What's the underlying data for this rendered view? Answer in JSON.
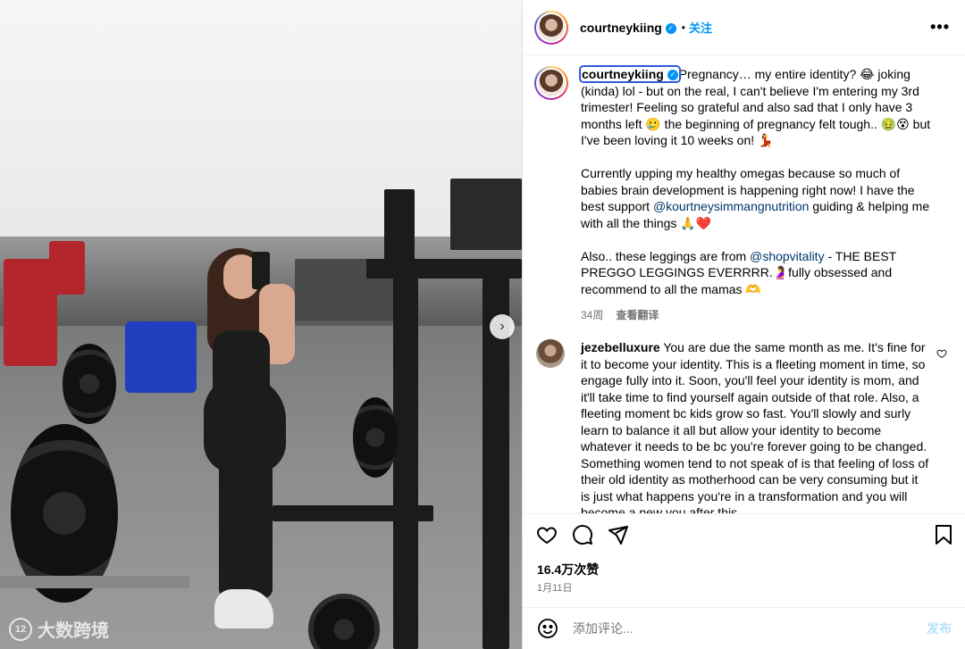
{
  "post": {
    "username": "courtneykiing",
    "follow_label": "关注",
    "more_label": "•••",
    "verified_mark": "✓"
  },
  "caption": {
    "username": "courtneykiing",
    "paragraph1": "Pregnancy… my entire identity? 😂 joking (kinda) lol - but on the real, I can't believe I'm entering my 3rd trimester! Feeling so grateful and also sad that I only have 3 months left 🥲 the beginning of pregnancy felt tough.. 🤢😵 but I've been loving it 10 weeks on! 💃",
    "paragraph2_before": "Currently upping my healthy omegas because so much of babies brain development is happening right now! I have the best support ",
    "paragraph2_mention": "@kourtneysimmangnutrition",
    "paragraph2_after": " guiding & helping me with all the things 🙏❤️",
    "paragraph3_before": "Also.. these leggings are from ",
    "paragraph3_mention": "@shopvitality",
    "paragraph3_after": " - THE BEST PREGGO LEGGINGS EVERRRR.🤰fully obsessed and recommend to all the mamas 🫶",
    "age": "34周",
    "translate_label": "查看翻译"
  },
  "comment": {
    "username": "jezebelluxure",
    "text": "You are due the same month as me. It's fine for it to become your identity. This is a fleeting moment in time, so engage fully into it. Soon, you'll feel your identity is mom, and it'll take time to find yourself again outside of that role. Also, a fleeting moment bc kids grow so fast. You'll slowly and surly learn to balance it all but allow your identity to become whatever it needs to be bc you're forever going to be changed. Something women tend to not speak of is that feeling of loss of their old identity as motherhood can be very consuming but it is just what happens you're in a transformation and you will become a new you after this."
  },
  "stats": {
    "likes": "16.4万次赞",
    "date": "1月11日"
  },
  "add_comment": {
    "placeholder": "添加评论...",
    "post_label": "发布"
  },
  "watermark": {
    "logo": "12",
    "text": "大数跨境"
  },
  "icons": [
    "heart-icon",
    "comment-icon",
    "share-icon",
    "bookmark-icon",
    "emoji-icon",
    "more-icon",
    "chevron-right-icon"
  ],
  "colors": {
    "accent": "#0095f6",
    "mention": "#00376b",
    "muted": "#737373",
    "post_disabled": "#b2dffc"
  }
}
